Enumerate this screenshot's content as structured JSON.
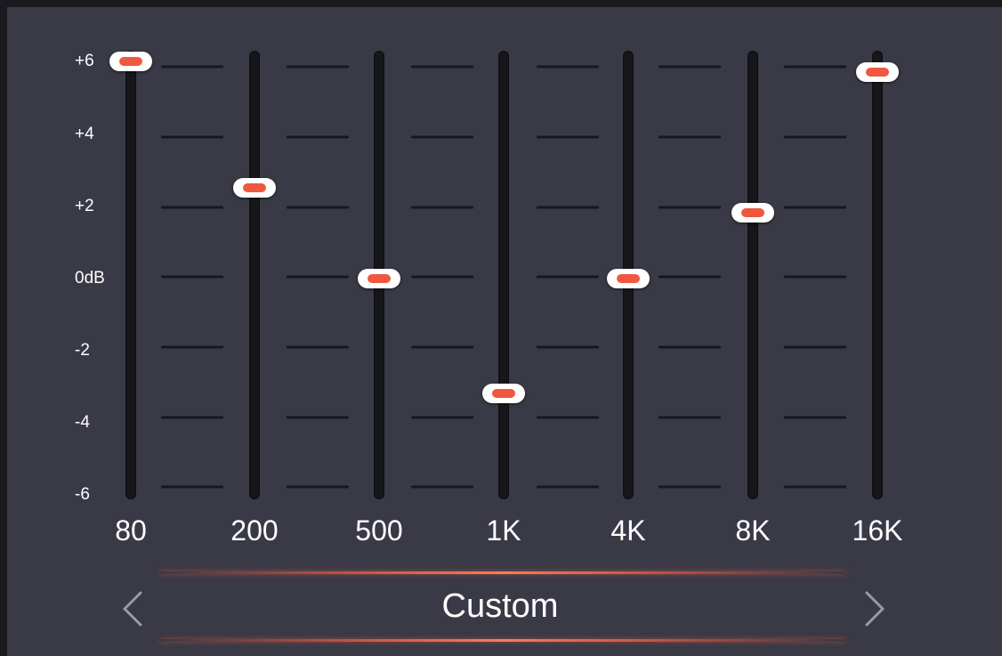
{
  "scale": {
    "labels": [
      "+6",
      "+4",
      "+2",
      "0dB",
      "-2",
      "-4",
      "-6"
    ],
    "min_db": -6,
    "max_db": 6
  },
  "bands": [
    {
      "label": "80",
      "gain_db": 6
    },
    {
      "label": "200",
      "gain_db": 2.5
    },
    {
      "label": "500",
      "gain_db": 0
    },
    {
      "label": "1K",
      "gain_db": -3.2
    },
    {
      "label": "4K",
      "gain_db": 0
    },
    {
      "label": "8K",
      "gain_db": 1.8
    },
    {
      "label": "16K",
      "gain_db": 5.7
    }
  ],
  "preset": {
    "name": "Custom",
    "prev_icon": "chevron-left-icon",
    "next_icon": "chevron-right-icon"
  },
  "colors": {
    "background": "#393a46",
    "accent": "#ef5840",
    "track": "#16171b",
    "text": "#ffffff"
  }
}
